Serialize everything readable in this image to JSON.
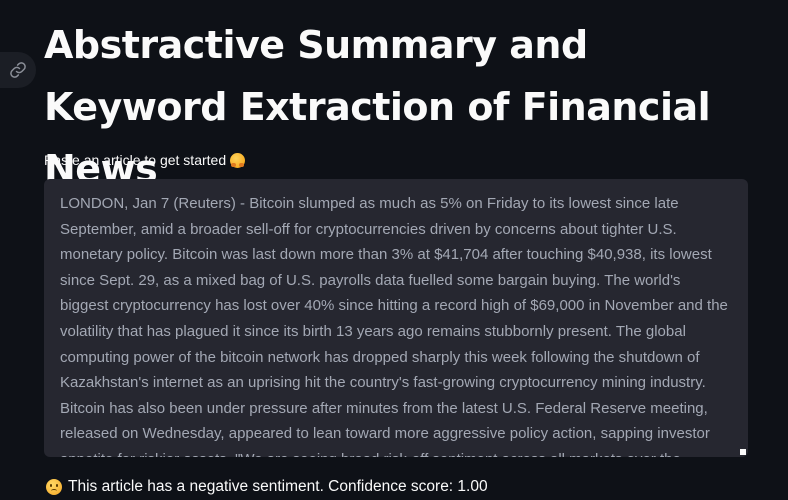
{
  "header": {
    "title": "Abstractive Summary and Keyword Extraction of Financial News",
    "anchor_icon": "link-icon"
  },
  "input": {
    "label": "Paste an article to get started",
    "label_emoji": "hugging-face-emoji",
    "value": "LONDON, Jan 7 (Reuters) - Bitcoin slumped as much as 5% on Friday to its lowest since late September, amid a broader sell-off for cryptocurrencies driven by concerns about tighter U.S. monetary policy. Bitcoin was last down more than 3% at $41,704 after touching $40,938, its lowest since Sept. 29, as a mixed bag of U.S. payrolls data fuelled some bargain buying. The world's biggest cryptocurrency has lost over 40% since hitting a record high of $69,000 in November and the volatility that has plagued it since its birth 13 years ago remains stubbornly present. The global computing power of the bitcoin network has dropped sharply this week following the shutdown of Kazakhstan's internet as an uprising hit the country's fast-growing cryptocurrency mining industry. Bitcoin has also been under pressure after minutes from the latest U.S. Federal Reserve meeting, released on Wednesday, appeared to lean toward more aggressive policy action, sapping investor appetite for riskier assets. \"We are seeing broad risk-off sentiment across all markets over the"
  },
  "result": {
    "emoji": "worried-face-emoji",
    "text": "This article has a negative sentiment. Confidence score: 1.00"
  },
  "colors": {
    "background": "#0e1117",
    "input_background": "#262730",
    "text": "#fafafa",
    "input_text": "#a3a8b4"
  }
}
